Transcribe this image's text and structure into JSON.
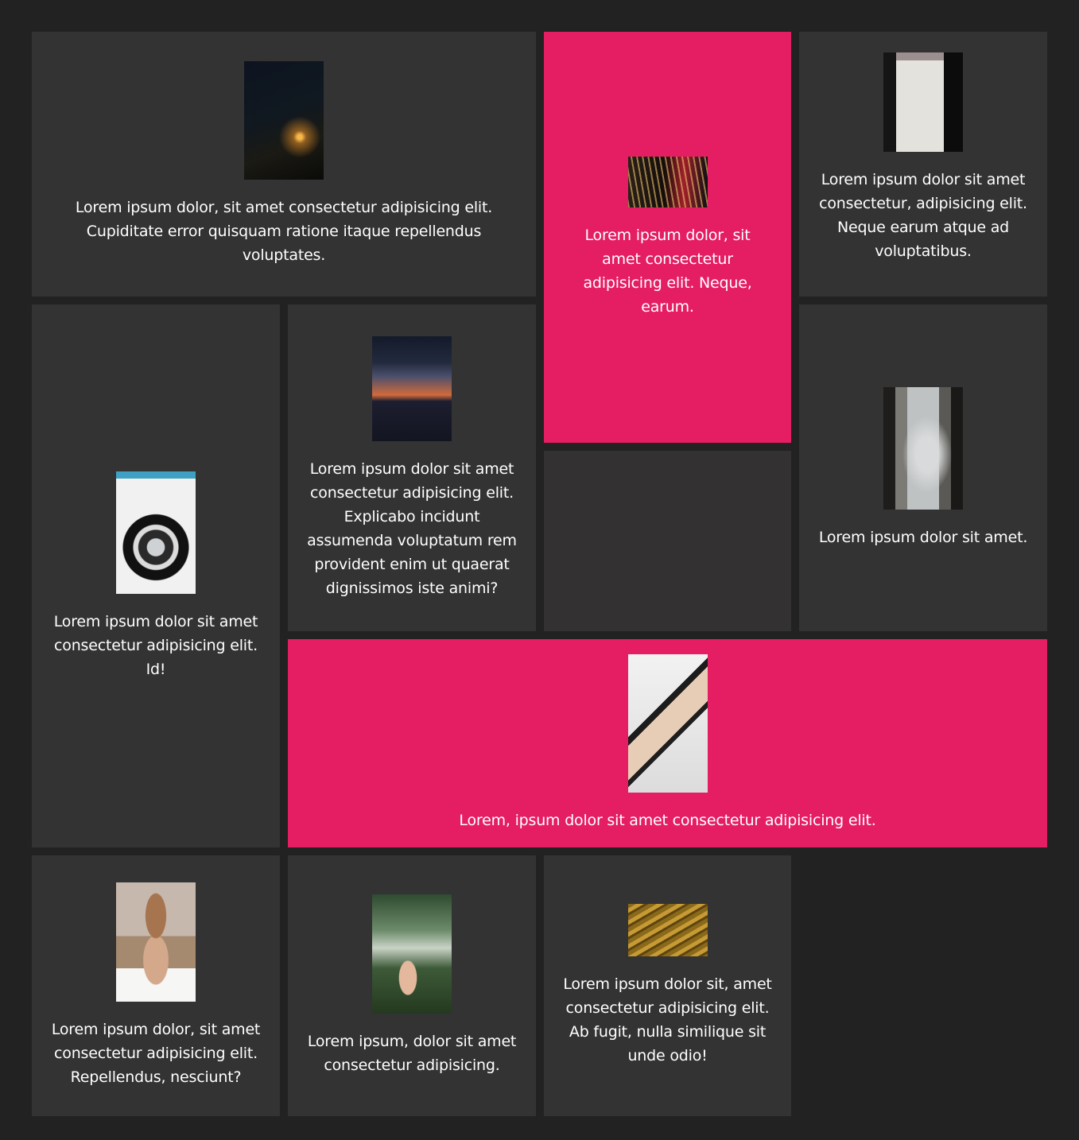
{
  "cards": [
    {
      "text": "Lorem ipsum dolor, sit amet consectetur adipisicing elit. Cupiditate error quisquam ratione itaque repellendus voluptates.",
      "image": "night-road-image"
    },
    {
      "text": "Lorem ipsum dolor, sit amet consectetur adipisicing elit. Neque, earum.",
      "image": "light-trails-image"
    },
    {
      "text": "Lorem ipsum dolor sit amet consectetur, adipisicing elit. Neque earum atque ad voluptatibus.",
      "image": "house-facade-image"
    },
    {
      "text": "Lorem ipsum dolor sit amet consectetur adipisicing elit. Id!",
      "image": "car-wheel-image"
    },
    {
      "text": "Lorem ipsum dolor sit amet consectetur adipisicing elit. Explicabo incidunt assumenda voluptatum rem provident enim ut quaerat dignissimos iste animi?",
      "image": "sunset-sky-image"
    },
    {
      "text": "Lorem ipsum dolor sit amet.",
      "image": "window-woman-image"
    },
    {
      "text": "Lorem, ipsum dolor sit amet consectetur adipisicing elit.",
      "image": "shoes-image"
    },
    {
      "text": "Lorem ipsum dolor, sit amet consectetur adipisicing elit. Repellendus, nesciunt?",
      "image": "woman-back-image"
    },
    {
      "text": "Lorem ipsum, dolor sit amet consectetur adipisicing.",
      "image": "hand-plant-image"
    },
    {
      "text": "Lorem ipsum dolor sit, amet consectetur adipisicing elit. Ab fugit, nulla similique sit unde odio!",
      "image": "gold-waves-image"
    }
  ],
  "colors": {
    "page_background": "#222222",
    "card_background": "#333333",
    "accent": "#e51d62",
    "text": "#ffffff"
  }
}
